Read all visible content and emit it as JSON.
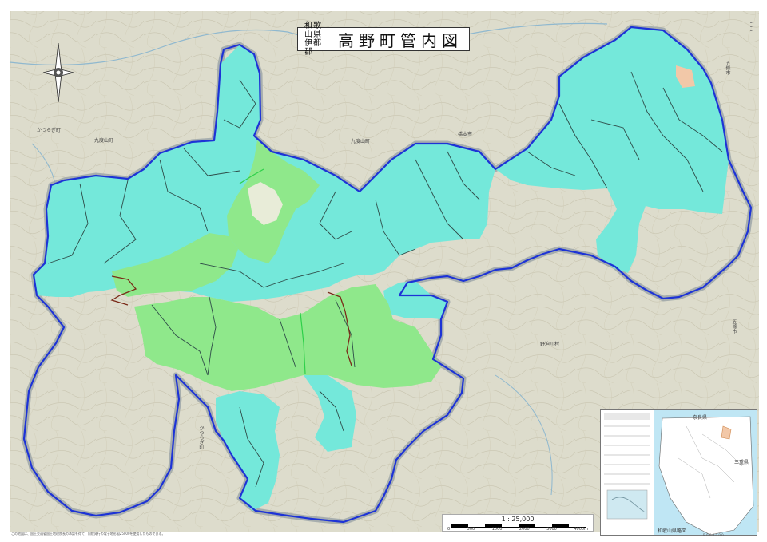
{
  "title": {
    "prefecture": "和歌山県",
    "district": "伊都郡",
    "main": "高野町管内図"
  },
  "scale": {
    "ratio": "1 : 25,000",
    "ticks": [
      "0",
      "500",
      "1000",
      "2000",
      "3000",
      "4000m"
    ]
  },
  "places": [
    "かつらぎ町",
    "九度山町",
    "九度山町",
    "橋本市",
    "五條市",
    "野迫川村",
    "五條市",
    "かつらぎ町"
  ],
  "inset": {
    "caption": "和歌山県略図",
    "label_top": "奈良県",
    "label_left": "三重県"
  },
  "footnote": "この地図は、国土交通省国土地理院長の承認を得て、同院発行の電子地形図25000を使用したものである。",
  "code": "R 0 0 0 0 0 0",
  "colors": {
    "topo_bg": "#dcdccd",
    "cyan": "#74e8da",
    "green": "#8fe88b",
    "boundary": "#1d33d6",
    "boundary_shadow": "#9aa3a6"
  }
}
